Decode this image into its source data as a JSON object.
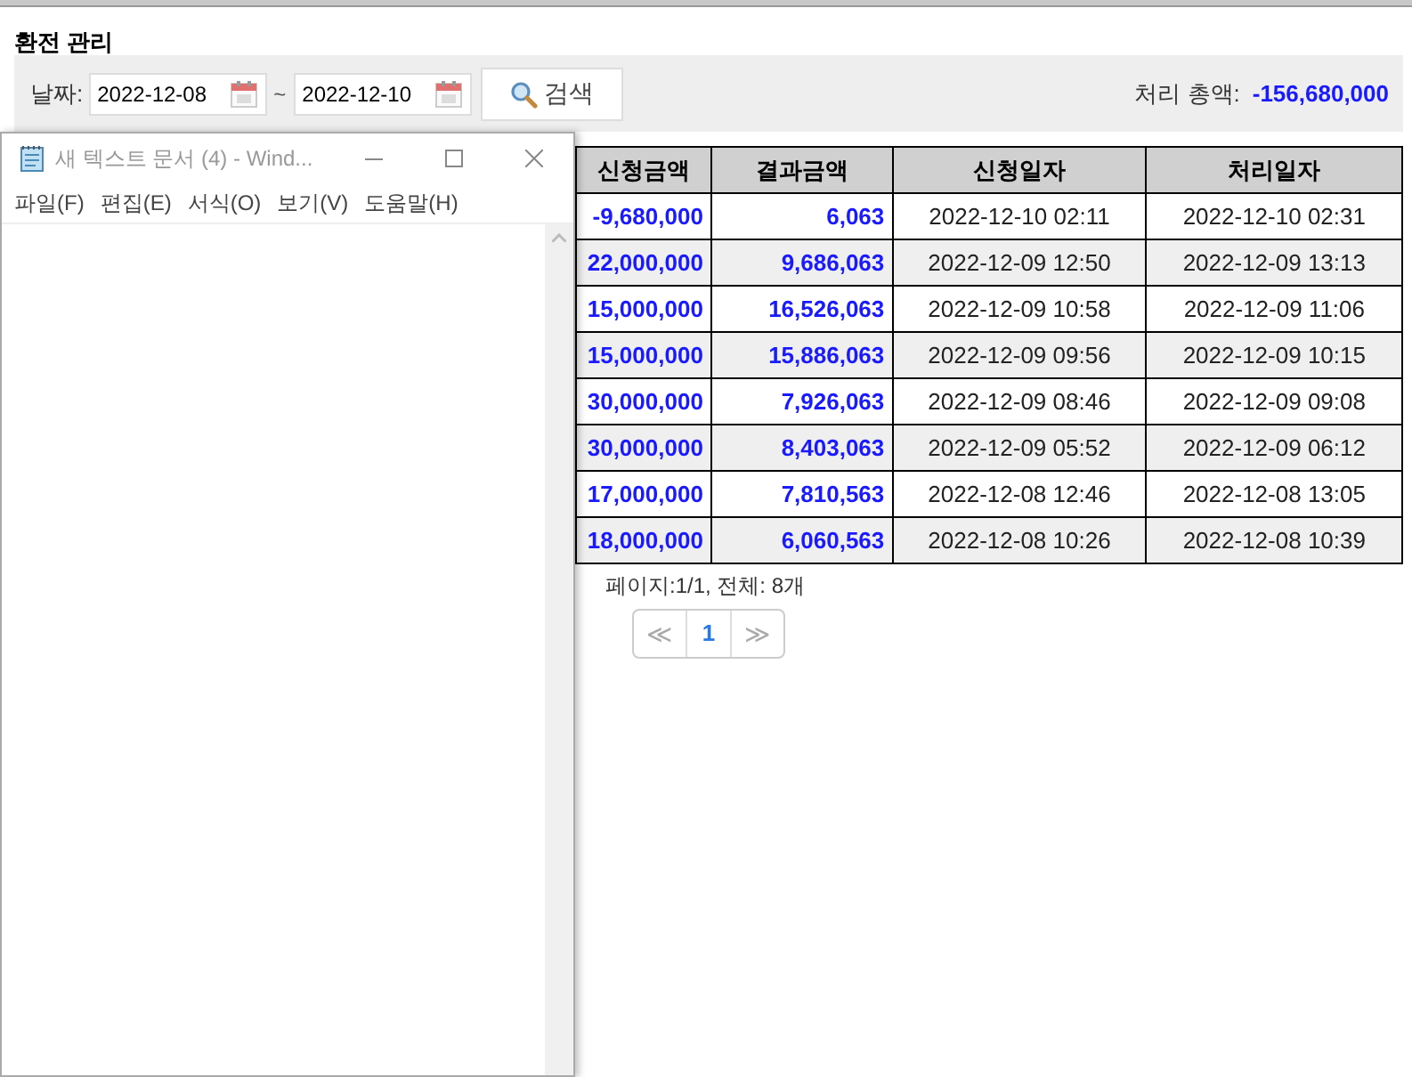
{
  "page_title": "환전 관리",
  "filter": {
    "label": "날짜:",
    "date_from": "2022-12-08",
    "separator": "~",
    "date_to": "2022-12-10",
    "search_button": "검색"
  },
  "total": {
    "label": "처리 총액:",
    "value": "-156,680,000"
  },
  "table": {
    "columns": [
      "신청금액",
      "결과금액",
      "신청일자",
      "처리일자"
    ],
    "rows": [
      {
        "amount": "-9,680,000",
        "result": "6,063",
        "requested": "2022-12-10 02:11",
        "processed": "2022-12-10 02:31"
      },
      {
        "amount": "22,000,000",
        "result": "9,686,063",
        "requested": "2022-12-09 12:50",
        "processed": "2022-12-09 13:13"
      },
      {
        "amount": "15,000,000",
        "result": "16,526,063",
        "requested": "2022-12-09 10:58",
        "processed": "2022-12-09 11:06"
      },
      {
        "amount": "15,000,000",
        "result": "15,886,063",
        "requested": "2022-12-09 09:56",
        "processed": "2022-12-09 10:15"
      },
      {
        "amount": "30,000,000",
        "result": "7,926,063",
        "requested": "2022-12-09 08:46",
        "processed": "2022-12-09 09:08"
      },
      {
        "amount": "30,000,000",
        "result": "8,403,063",
        "requested": "2022-12-09 05:52",
        "processed": "2022-12-09 06:12"
      },
      {
        "amount": "17,000,000",
        "result": "7,810,563",
        "requested": "2022-12-08 12:46",
        "processed": "2022-12-08 13:05"
      },
      {
        "amount": "18,000,000",
        "result": "6,060,563",
        "requested": "2022-12-08 10:26",
        "processed": "2022-12-08 10:39"
      }
    ]
  },
  "pagination": {
    "info": "페이지:1/1, 전체: 8개",
    "prev": "≪",
    "pages": [
      {
        "label": "1",
        "selected": true
      }
    ],
    "next": "≫"
  },
  "notepad": {
    "title": "새 텍스트 문서 (4) - Wind...",
    "menu": [
      "파일(F)",
      "편집(E)",
      "서식(O)",
      "보기(V)",
      "도움말(H)"
    ]
  }
}
